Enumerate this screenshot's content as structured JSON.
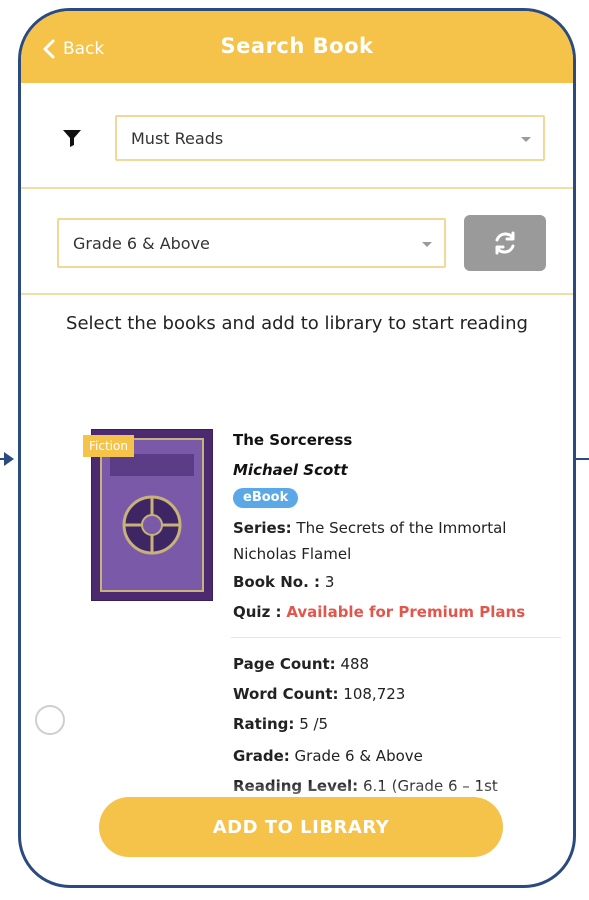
{
  "header": {
    "back_label": "Back",
    "title": "Search Book"
  },
  "filters": {
    "list_value": "Must Reads",
    "grade_value": "Grade 6 & Above"
  },
  "instruction": "Select the books and add to library to start reading",
  "book": {
    "cover_badge": "Fiction",
    "title": "The Sorceress",
    "author": "Michael Scott",
    "format_badge": "eBook",
    "series_label": "Series:",
    "series_value": "The Secrets of the Immortal Nicholas Flamel",
    "book_no_label": "Book No. :",
    "book_no_value": "3",
    "quiz_label": "Quiz :",
    "quiz_value": "Available for Premium Plans",
    "page_count_label": "Page Count:",
    "page_count_value": "488",
    "word_count_label": "Word Count:",
    "word_count_value": "108,723",
    "rating_label": "Rating:",
    "rating_value": "5 /5",
    "grade_label": "Grade:",
    "grade_value": "Grade 6 & Above",
    "reading_level_label": "Reading Level:",
    "reading_level_value": "6.1 (Grade 6 – 1st"
  },
  "cta": {
    "label": "ADD TO LIBRARY"
  },
  "colors": {
    "primary": "#f5c24a",
    "frame": "#2b4a7e",
    "badge_blue": "#5aa8e6",
    "quiz_red": "#e2564c",
    "refresh_gray": "#9a9a9a"
  },
  "icons": {
    "back": "chevron-left-icon",
    "filter": "filter-icon",
    "refresh": "refresh-icon",
    "dropdown": "chevron-down-icon",
    "radio": "radio-unchecked-icon"
  }
}
